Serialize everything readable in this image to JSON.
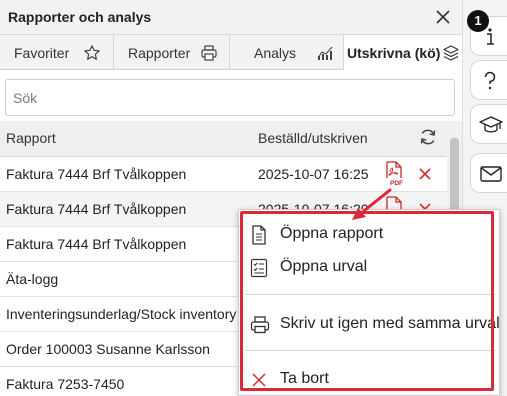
{
  "window": {
    "title": "Rapporter och analys"
  },
  "tabs": [
    {
      "label": "Favoriter",
      "icon": "star-icon"
    },
    {
      "label": "Rapporter",
      "icon": "printer-icon"
    },
    {
      "label": "Analys",
      "icon": "bar-chart-icon"
    },
    {
      "label": "Utskrivna (kö)",
      "icon": "layers-icon",
      "active": true
    }
  ],
  "search": {
    "placeholder": "Sök",
    "value": ""
  },
  "table": {
    "columns": {
      "report": "Rapport",
      "ordered": "Beställd/utskriven"
    },
    "rows": [
      {
        "name": "Faktura 7444 Brf Tvålkoppen",
        "date": "2025-10-07 16:25",
        "pdf": true,
        "delete": true
      },
      {
        "name": "Faktura 7444 Brf Tvålkoppen",
        "date": "2025-10-07 16:20",
        "pdf": true,
        "delete": true
      },
      {
        "name": "Faktura 7444 Brf Tvålkoppen",
        "date": "",
        "pdf": false,
        "delete": false
      },
      {
        "name": "Äta-logg",
        "date": "",
        "pdf": false,
        "delete": false
      },
      {
        "name": "Inventeringsunderlag/Stock inventory",
        "date": "",
        "pdf": false,
        "delete": false
      },
      {
        "name": "Order 100003 Susanne Karlsson",
        "date": "",
        "pdf": false,
        "delete": false
      },
      {
        "name": "Faktura 7253-7450",
        "date": "",
        "pdf": false,
        "delete": false
      }
    ]
  },
  "context_menu": {
    "items": [
      {
        "label": "Öppna rapport",
        "icon": "document-icon"
      },
      {
        "label": "Öppna urval",
        "icon": "checklist-icon"
      },
      {
        "label": "Skriv ut igen med samma urval",
        "icon": "printer-icon"
      },
      {
        "label": "Ta bort",
        "icon": "close-icon"
      }
    ]
  },
  "sidebar": {
    "badge": "1",
    "buttons": [
      "info-icon",
      "help-icon",
      "graduation-cap-icon",
      "mail-icon"
    ]
  },
  "colors": {
    "accent_red": "#d9293b",
    "header_bg": "#f2f2f2",
    "row_alt_bg": "#f4f4f4"
  }
}
